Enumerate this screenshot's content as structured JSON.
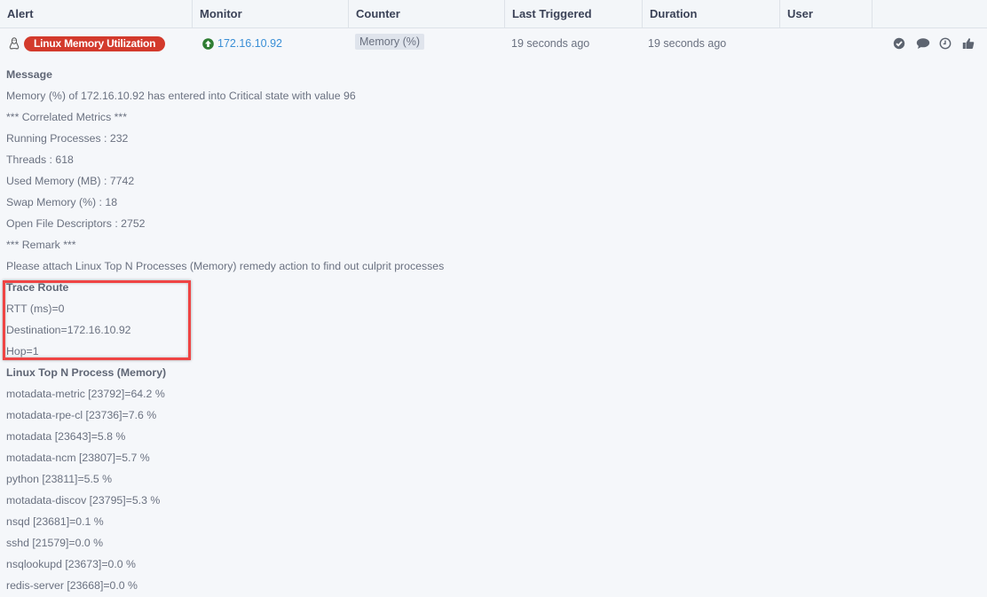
{
  "table": {
    "columns": [
      "Alert",
      "Monitor",
      "Counter",
      "Last Triggered",
      "Duration",
      "User",
      ""
    ],
    "row": {
      "os_icon": "linux-tux-icon",
      "alert_name": "Linux Memory Utilization",
      "alert_color": "#d33a2c",
      "monitor_status_icon": "arrow-up-circle-icon",
      "monitor_status_color": "#2e7d32",
      "monitor": "172.16.10.92",
      "counter": "Memory (%)",
      "last_triggered": "19 seconds ago",
      "duration": "19 seconds ago",
      "user": "",
      "actions": [
        {
          "name": "acknowledge",
          "icon": "check-circle-icon"
        },
        {
          "name": "comment",
          "icon": "comment-icon"
        },
        {
          "name": "snooze",
          "icon": "clock-icon"
        },
        {
          "name": "like",
          "icon": "thumbs-up-icon"
        }
      ]
    }
  },
  "details": {
    "message_title": "Message",
    "message": "Memory (%) of 172.16.10.92 has entered into Critical state with value 96",
    "correlated_header": "*** Correlated Metrics ***",
    "correlated_metrics": [
      "Running Processes : 232",
      "Threads : 618",
      "Used Memory (MB) : 7742",
      "Swap Memory (%) : 18",
      "Open File Descriptors : 2752"
    ],
    "remark_header": "*** Remark ***",
    "remark": "Please attach Linux Top N Processes (Memory) remedy action to find out culprit processes",
    "trace_route_title": "Trace Route",
    "trace_route": [
      "RTT (ms)=0",
      "Destination=172.16.10.92",
      "Hop=1"
    ],
    "top_n_title": "Linux Top N Process (Memory)",
    "top_n_processes": [
      "motadata-metric [23792]=64.2 %",
      "motadata-rpe-cl [23736]=7.6 %",
      "motadata [23643]=5.8 %",
      "motadata-ncm [23807]=5.7 %",
      "python [23811]=5.5 %",
      "motadata-discov [23795]=5.3 %",
      "nsqd [23681]=0.1 %",
      "sshd [21579]=0.0 %",
      "nsqlookupd [23673]=0.0 %",
      "redis-server [23668]=0.0 %"
    ]
  },
  "highlight_color": "#ef4444"
}
